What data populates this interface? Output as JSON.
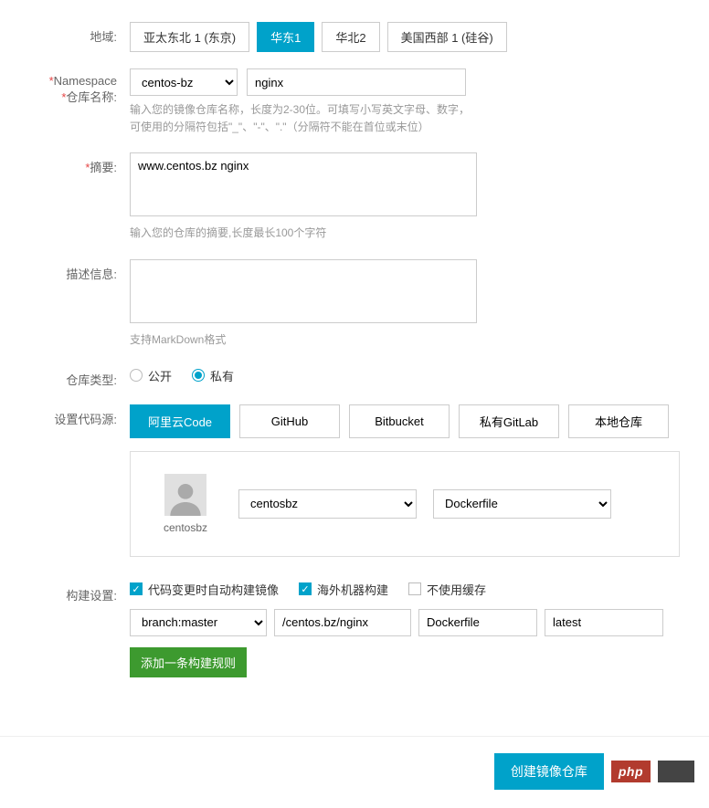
{
  "labels": {
    "region": "地域:",
    "namespace": "Namespace",
    "repo": "仓库名称:",
    "summary": "摘要:",
    "desc": "描述信息:",
    "type": "仓库类型:",
    "source": "设置代码源:",
    "build": "构建设置:"
  },
  "regions": [
    {
      "label": "亚太东北 1 (东京)",
      "active": false
    },
    {
      "label": "华东1",
      "active": true
    },
    {
      "label": "华北2",
      "active": false
    },
    {
      "label": "美国西部 1 (硅谷)",
      "active": false
    }
  ],
  "namespace": {
    "value": "centos-bz"
  },
  "repo_name": {
    "value": "nginx"
  },
  "repo_helper": "输入您的镜像仓库名称，长度为2-30位。可填写小写英文字母、数字，可使用的分隔符包括\"_\"、\"-\"、\".\"（分隔符不能在首位或末位）",
  "summary": {
    "value": "www.centos.bz nginx",
    "helper": "输入您的仓库的摘要,长度最长100个字符"
  },
  "desc": {
    "value": "",
    "helper": "支持MarkDown格式"
  },
  "repo_type": {
    "public": "公开",
    "private": "私有",
    "selected": "private"
  },
  "sources": [
    {
      "label": "阿里云Code",
      "active": true
    },
    {
      "label": "GitHub",
      "active": false
    },
    {
      "label": "Bitbucket",
      "active": false
    },
    {
      "label": "私有GitLab",
      "active": false
    },
    {
      "label": "本地仓库",
      "active": false
    }
  ],
  "source_user": "centosbz",
  "source_repo_select": "centosbz",
  "source_dockerfile_select": "Dockerfile",
  "build_checks": [
    {
      "label": "代码变更时自动构建镜像",
      "checked": true
    },
    {
      "label": "海外机器构建",
      "checked": true
    },
    {
      "label": "不使用缓存",
      "checked": false
    }
  ],
  "build_rule": {
    "branch": "branch:master",
    "path": "/centos.bz/nginx",
    "dockerfile": "Dockerfile",
    "tag": "latest"
  },
  "add_rule_label": "添加一条构建规则",
  "submit_label": "创建镜像仓库",
  "php_badge": "php"
}
